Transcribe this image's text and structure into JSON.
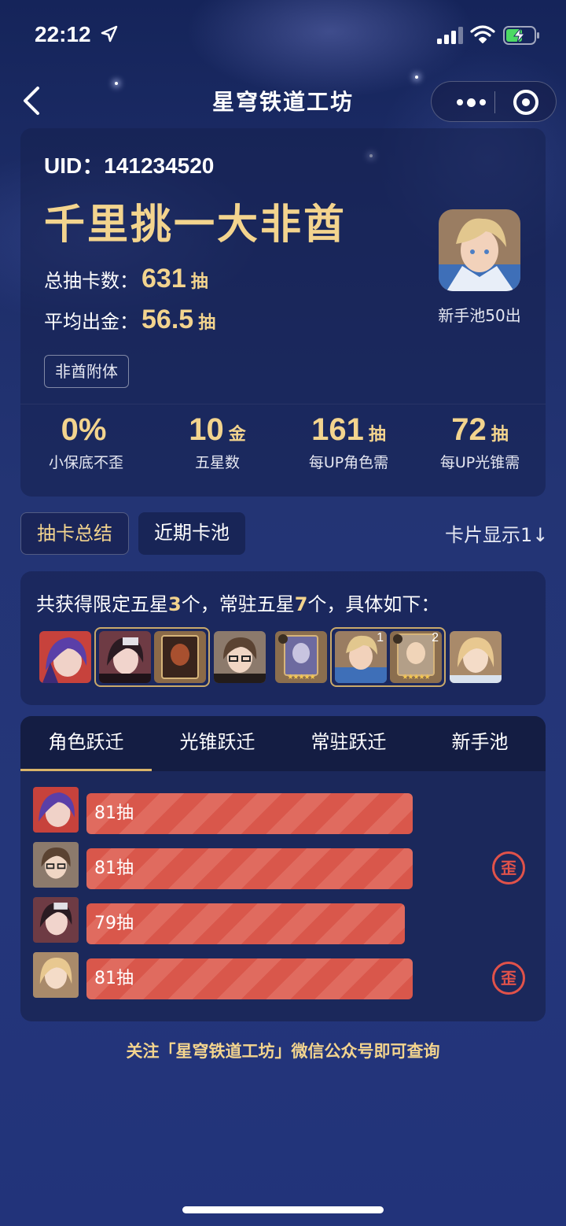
{
  "status_bar": {
    "time": "22:12"
  },
  "nav": {
    "title": "星穹铁道工坊"
  },
  "summary": {
    "uid": "UID：141234520",
    "rank_title": "千里挑一大非酋",
    "total_pulls_label": "总抽卡数：",
    "total_pulls_value": "631",
    "total_pulls_unit": "抽",
    "avg_gold_label": "平均出金：",
    "avg_gold_value": "56.5",
    "avg_gold_unit": "抽",
    "badge": "非酋附体",
    "avatar_caption": "新手池50出"
  },
  "metrics": [
    {
      "value": "0%",
      "unit": "",
      "label": "小保底不歪"
    },
    {
      "value": "10",
      "unit": "金",
      "label": "五星数"
    },
    {
      "value": "161",
      "unit": "抽",
      "label": "每UP角色需"
    },
    {
      "value": "72",
      "unit": "抽",
      "label": "每UP光锥需"
    }
  ],
  "segments": {
    "summary_tab": "抽卡总结",
    "recent_tab": "近期卡池",
    "display_toggle": "卡片显示1↓"
  },
  "acquisition": {
    "prefix": "共获得限定五星",
    "limited_count": "3",
    "middle": "个，常驻五星",
    "standard_count": "7",
    "suffix": "个，具体如下："
  },
  "acquired_icons": [
    {
      "name": "acheron",
      "badge": ""
    },
    {
      "name": "sparkle",
      "badge": ""
    },
    {
      "name": "lightcone-earthly",
      "badge": ""
    },
    {
      "name": "welt",
      "badge": ""
    },
    {
      "name": "lightcone-stars",
      "badge": ""
    },
    {
      "name": "trailblazer-a",
      "badge": "1"
    },
    {
      "name": "lightcone-trailblazer",
      "badge": "2"
    },
    {
      "name": "yanqing",
      "badge": ""
    }
  ],
  "warp_tabs": [
    "角色跃迁",
    "光锥跃迁",
    "常驻跃迁",
    "新手池"
  ],
  "warp_rows": [
    {
      "label": "81抽",
      "pulls": 81,
      "off_banner": false
    },
    {
      "label": "81抽",
      "pulls": 81,
      "off_banner": true
    },
    {
      "label": "79抽",
      "pulls": 79,
      "off_banner": false
    },
    {
      "label": "81抽",
      "pulls": 81,
      "off_banner": true
    }
  ],
  "wai_stamp": "歪",
  "footer": "关注「星穹铁道工坊」微信公众号即可查询",
  "colors": {
    "gold": "#f3d48e",
    "bar_red": "#d9574b",
    "stamp_red": "#e0524a",
    "tab_underline": "#d9b46a"
  }
}
